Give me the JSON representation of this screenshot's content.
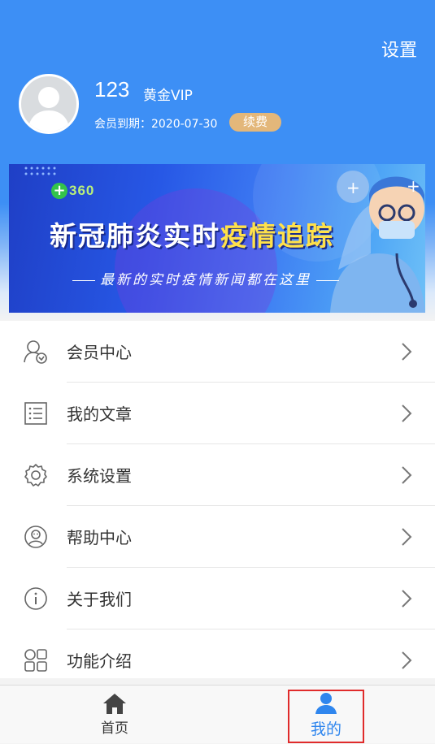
{
  "header": {
    "settings_label": "设置",
    "username": "123",
    "vip_level": "黄金VIP",
    "expire_text": "会员到期：2020-07-30",
    "renew_label": "续费",
    "bg_color": "#3d8ff5"
  },
  "banner": {
    "logo_text": "360",
    "title_main": "新冠肺炎实时",
    "title_highlight": "疫情追踪",
    "subtitle": "最新的实时疫情新闻都在这里"
  },
  "menu": {
    "items": [
      {
        "label": "会员中心",
        "icon": "member-icon"
      },
      {
        "label": "我的文章",
        "icon": "article-list-icon"
      },
      {
        "label": "系统设置",
        "icon": "gear-icon"
      },
      {
        "label": "帮助中心",
        "icon": "help-icon"
      },
      {
        "label": "关于我们",
        "icon": "info-icon"
      },
      {
        "label": "功能介绍",
        "icon": "grid-icon"
      }
    ]
  },
  "bottom_nav": {
    "items": [
      {
        "label": "首页",
        "icon": "home-icon"
      },
      {
        "label": "我的",
        "icon": "person-icon",
        "active": true
      }
    ],
    "active_color": "#2f86ee"
  }
}
